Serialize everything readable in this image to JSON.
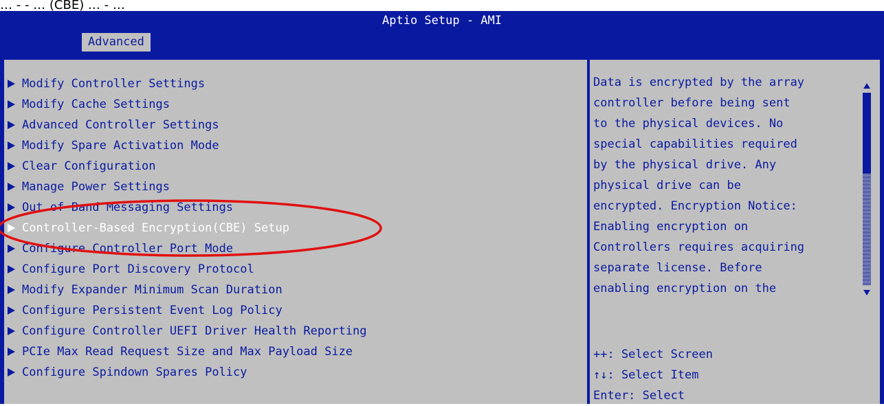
{
  "caption": "… ‑ ‑ … (CBE) … ‑ …",
  "header": {
    "title": "Aptio Setup - AMI",
    "tab": "Advanced"
  },
  "menu": {
    "items": [
      {
        "label": "Modify Controller Settings"
      },
      {
        "label": "Modify Cache Settings"
      },
      {
        "label": "Advanced Controller Settings"
      },
      {
        "label": "Modify Spare Activation Mode"
      },
      {
        "label": "Clear Configuration"
      },
      {
        "label": "Manage Power Settings"
      },
      {
        "label": "Out of Band Messaging Settings"
      },
      {
        "label": "Controller-Based Encryption(CBE) Setup",
        "selected": true
      },
      {
        "label": "Configure Controller Port Mode"
      },
      {
        "label": "Configure Port Discovery Protocol"
      },
      {
        "label": "Modify Expander Minimum Scan Duration"
      },
      {
        "label": "Configure Persistent Event Log Policy"
      },
      {
        "label": "Configure Controller UEFI Driver Health Reporting"
      },
      {
        "label": "PCIe Max Read Request Size and Max Payload Size"
      },
      {
        "label": "Configure Spindown Spares Policy"
      }
    ]
  },
  "help": {
    "lines": [
      "Data is encrypted by the array",
      "controller before being sent",
      "to the physical devices. No",
      "special capabilities required",
      "by the physical drive. Any",
      "physical drive can be",
      "encrypted. Encryption Notice:",
      "Enabling encryption on",
      "Controllers requires acquiring",
      "separate license. Before",
      "enabling encryption on the"
    ],
    "keys": [
      "++: Select Screen",
      "↑↓: Select Item",
      "Enter: Select"
    ]
  },
  "colors": {
    "bios_blue": "#0a1aa0",
    "panel_gray": "#c0c0c0",
    "highlight_white": "#ffffff",
    "annotation_red": "#e01010"
  }
}
